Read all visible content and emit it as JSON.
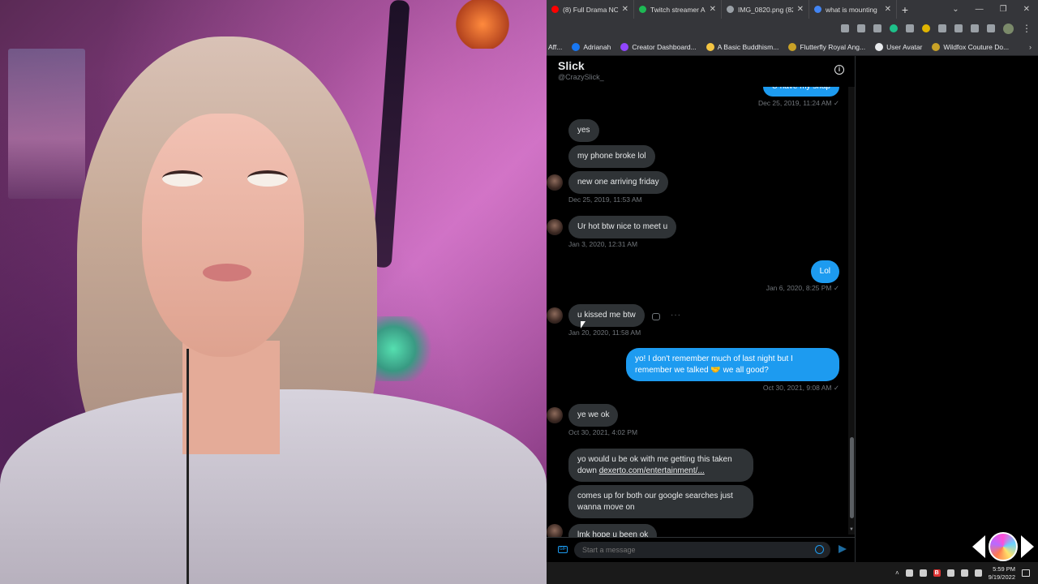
{
  "browser": {
    "tabs": [
      {
        "title": "(8) Full Drama NO",
        "color": "#ff0000"
      },
      {
        "title": "Twitch streamer A",
        "color": "#1db954"
      },
      {
        "title": "IMG_0820.png (82",
        "color": "#9aa0a6"
      },
      {
        "title": "what is mounting",
        "color": "#4285f4"
      }
    ],
    "new_tab": "+",
    "bookmarks": [
      {
        "label": "Aff...",
        "color": "#aaaaaa"
      },
      {
        "label": "Adrianah",
        "color": "#1877f2"
      },
      {
        "label": "Creator Dashboard...",
        "color": "#e8eaed"
      },
      {
        "label": "A Basic Buddhism...",
        "color": "#f4c542"
      },
      {
        "label": "Flutterfly Royal Ang...",
        "color": "#c9a227"
      },
      {
        "label": "User Avatar",
        "color": "#e8eaed"
      },
      {
        "label": "Wildfox Couture Do...",
        "color": "#c9a227"
      }
    ],
    "bookmarks_more": "›"
  },
  "dm": {
    "name": "Slick",
    "handle": "@CrazySlick_",
    "info_icon": "i",
    "messages": {
      "m0_text": "U have my snap",
      "m0_meta": "Dec 25, 2019, 11:24 AM ✓",
      "m1_text": "yes",
      "m2_text": "my phone broke lol",
      "m3_text": "new one arriving friday",
      "m3_meta": "Dec 25, 2019, 11:53 AM",
      "m4_text": "Ur hot btw nice to meet u",
      "m4_meta": "Jan 3, 2020, 12:31 AM",
      "m5_text": "Lol",
      "m5_meta": "Jan 6, 2020, 8:25 PM ✓",
      "m6_text": "u kissed me btw",
      "m6_meta": "Jan 20, 2020, 11:58 AM",
      "m7_text": "yo! I don't remember much of last night but I remember we talked 🤝 we all good?",
      "m7_meta": "Oct 30, 2021, 9:08 AM ✓",
      "m8_text": "ye we ok",
      "m8_meta": "Oct 30, 2021, 4:02 PM",
      "m9_text": "yo would u be ok with me getting this taken down ",
      "m9_link": "dexerto.com/entertainment/...",
      "m10_text": "comes up for both our google searches just wanna move on",
      "m11_text": "lmk hope u been ok"
    },
    "more_dots": "···",
    "composer_placeholder": "Start a message",
    "gif_label": "GIF"
  },
  "taskbar": {
    "time": "5:59 PM",
    "date": "9/19/2022",
    "up_arrow": "˄",
    "b_label": "B"
  },
  "colors": {
    "twitter_blue": "#1d9bf0",
    "incoming_bubble": "#2f3336",
    "timestamp_gray": "#71767b"
  }
}
